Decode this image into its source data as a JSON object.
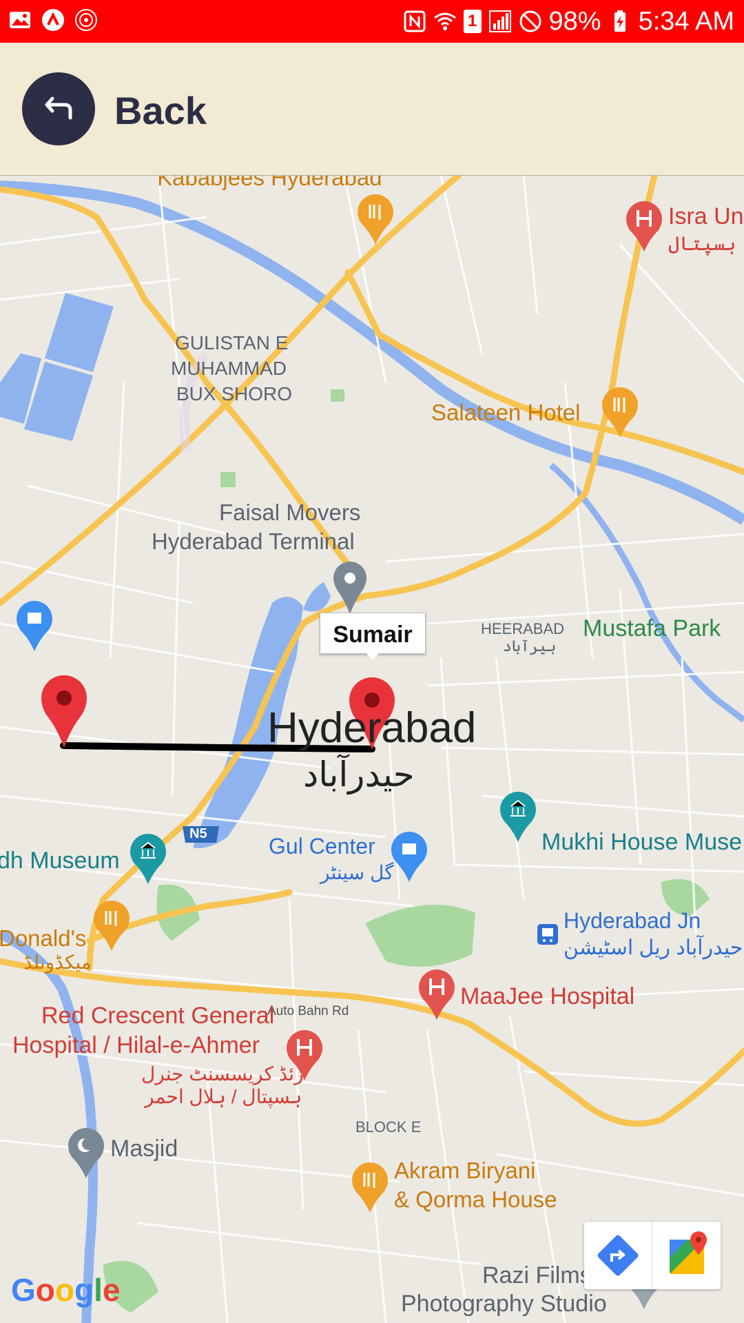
{
  "status_bar": {
    "battery": "98%",
    "time": "5:34 AM",
    "sim_badge": "1",
    "icons": [
      "image-icon",
      "app-a-icon",
      "emblem-icon",
      "nfc-icon",
      "wifi-icon",
      "signal-icon",
      "blocked-icon",
      "battery-charging-icon"
    ],
    "bg_color": "#fe0000"
  },
  "header": {
    "back_label": "Back",
    "bg_color": "#f3ead3",
    "button_color": "#2b2e45"
  },
  "map": {
    "info_window": {
      "label": "Sumair"
    },
    "city": {
      "name": "Hyderabad",
      "urdu": "حیدرآباد"
    },
    "places": {
      "kababjees": "Kababjees Hyderabad",
      "isra_partial": "Isra Un",
      "isra_urdu": "اسراء ہسپتال",
      "gulistan_1": "GULISTAN E",
      "gulistan_2": "MUHAMMAD",
      "gulistan_3": "BUX SHORO",
      "salateen": "Salateen Hotel",
      "faisal_1": "Faisal Movers",
      "faisal_2": "Hyderabad Terminal",
      "heerabad": "HEERABAD",
      "heerabad_urdu": "ہیرآباد",
      "mustafa": "Mustafa Park",
      "museum_left": "dh Museum",
      "highway": "N5",
      "gul_center": "Gul Center",
      "gul_center_urdu": "گل سینٹر",
      "mukhi": "Mukhi House Muse",
      "mcdonalds": "Donald's",
      "mcdonalds_urdu": "میکڈونلڈ",
      "hyderabad_jn": "Hyderabad Jn",
      "hyderabad_jn_urdu": "حیدرآباد ریل اسٹیشن",
      "maajee": "MaaJee Hospital",
      "auto_bahn": "Auto Bahn Rd",
      "red_crescent_1": "Red Crescent General",
      "red_crescent_2": "Hospital / Hilal-e-Ahmer",
      "red_crescent_urdu_1": "رئڈ کریسسنٹ جنرل",
      "red_crescent_urdu_2": "ہسپتال / ہلال احمر",
      "block_e": "BLOCK E",
      "masjid": "Masjid",
      "akram_1": "Akram Biryani",
      "akram_2": "& Qorma House",
      "razi_1": "Razi Films &",
      "razi_2": "Photography Studio"
    },
    "logo": "Google"
  }
}
